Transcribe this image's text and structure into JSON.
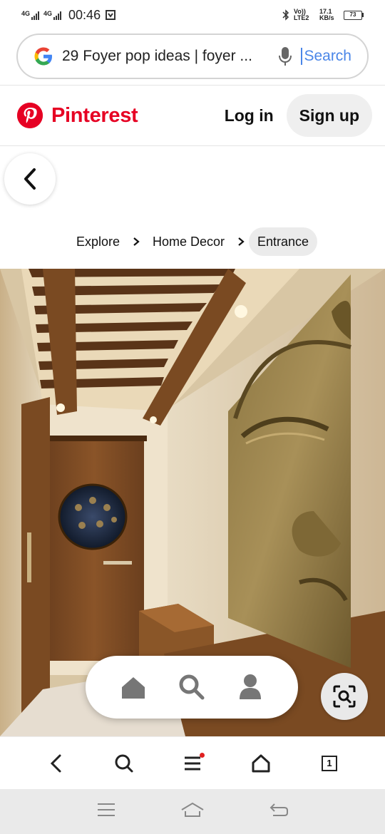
{
  "status_bar": {
    "net1": "4G",
    "net2": "4G",
    "time": "00:46",
    "volte": "Vo)) LTE2",
    "speed": "17.1 KB/s",
    "battery": "73"
  },
  "search": {
    "query": "29 Foyer pop ideas | foyer ...",
    "button_label": "Search"
  },
  "header": {
    "brand": "Pinterest",
    "login_label": "Log in",
    "signup_label": "Sign up"
  },
  "breadcrumb": {
    "items": [
      "Explore",
      "Home Decor",
      "Entrance"
    ]
  },
  "browser_toolbar": {
    "tab_count": "1"
  },
  "colors": {
    "brand_red": "#e60023",
    "search_blue": "#4a86e8"
  }
}
